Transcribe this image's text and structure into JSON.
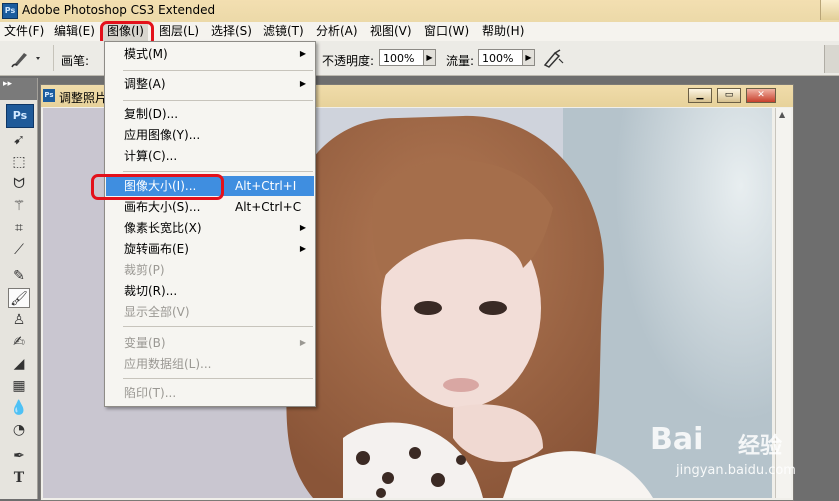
{
  "window": {
    "title": "Adobe Photoshop CS3 Extended",
    "app_badge": "Ps"
  },
  "menubar": {
    "items": [
      "文件(F)",
      "编辑(E)",
      "图像(I)",
      "图层(L)",
      "选择(S)",
      "滤镜(T)",
      "分析(A)",
      "视图(V)",
      "窗口(W)",
      "帮助(H)"
    ],
    "active": "图像(I)"
  },
  "options": {
    "brush_label": "画笔:",
    "opacity_label": "不透明度:",
    "opacity_value": "100%",
    "flow_label": "流量:",
    "flow_value": "100%"
  },
  "toolbox": {
    "logo": "Ps",
    "collapse": "▸▸"
  },
  "document": {
    "title": "调整照片",
    "icon": "Ps"
  },
  "image_menu": {
    "items": [
      {
        "label": "模式(M)",
        "shortcut": "",
        "submenu": true,
        "disabled": false,
        "highlighted": false
      },
      {
        "label": "调整(A)",
        "shortcut": "",
        "submenu": true,
        "disabled": false,
        "highlighted": false
      },
      {
        "label": "复制(D)...",
        "shortcut": "",
        "submenu": false,
        "disabled": false,
        "highlighted": false
      },
      {
        "label": "应用图像(Y)...",
        "shortcut": "",
        "submenu": false,
        "disabled": false,
        "highlighted": false
      },
      {
        "label": "计算(C)...",
        "shortcut": "",
        "submenu": false,
        "disabled": false,
        "highlighted": false
      },
      {
        "label": "图像大小(I)...",
        "shortcut": "Alt+Ctrl+I",
        "submenu": false,
        "disabled": false,
        "highlighted": true
      },
      {
        "label": "画布大小(S)...",
        "shortcut": "Alt+Ctrl+C",
        "submenu": false,
        "disabled": false,
        "highlighted": false
      },
      {
        "label": "像素长宽比(X)",
        "shortcut": "",
        "submenu": true,
        "disabled": false,
        "highlighted": false
      },
      {
        "label": "旋转画布(E)",
        "shortcut": "",
        "submenu": true,
        "disabled": false,
        "highlighted": false
      },
      {
        "label": "裁剪(P)",
        "shortcut": "",
        "submenu": false,
        "disabled": true,
        "highlighted": false
      },
      {
        "label": "裁切(R)...",
        "shortcut": "",
        "submenu": false,
        "disabled": false,
        "highlighted": false
      },
      {
        "label": "显示全部(V)",
        "shortcut": "",
        "submenu": false,
        "disabled": true,
        "highlighted": false
      },
      {
        "label": "变量(B)",
        "shortcut": "",
        "submenu": true,
        "disabled": true,
        "highlighted": false
      },
      {
        "label": "应用数据组(L)...",
        "shortcut": "",
        "submenu": false,
        "disabled": true,
        "highlighted": false
      },
      {
        "label": "陷印(T)...",
        "shortcut": "",
        "submenu": false,
        "disabled": true,
        "highlighted": false
      }
    ]
  },
  "watermark": {
    "brand": "Bai",
    "brand2": "经验",
    "url": "jingyan.baidu.com"
  },
  "colors": {
    "highlight": "#3f8ee0",
    "annotation_red": "#e3111b",
    "titlebar": "#ecd9a8"
  }
}
